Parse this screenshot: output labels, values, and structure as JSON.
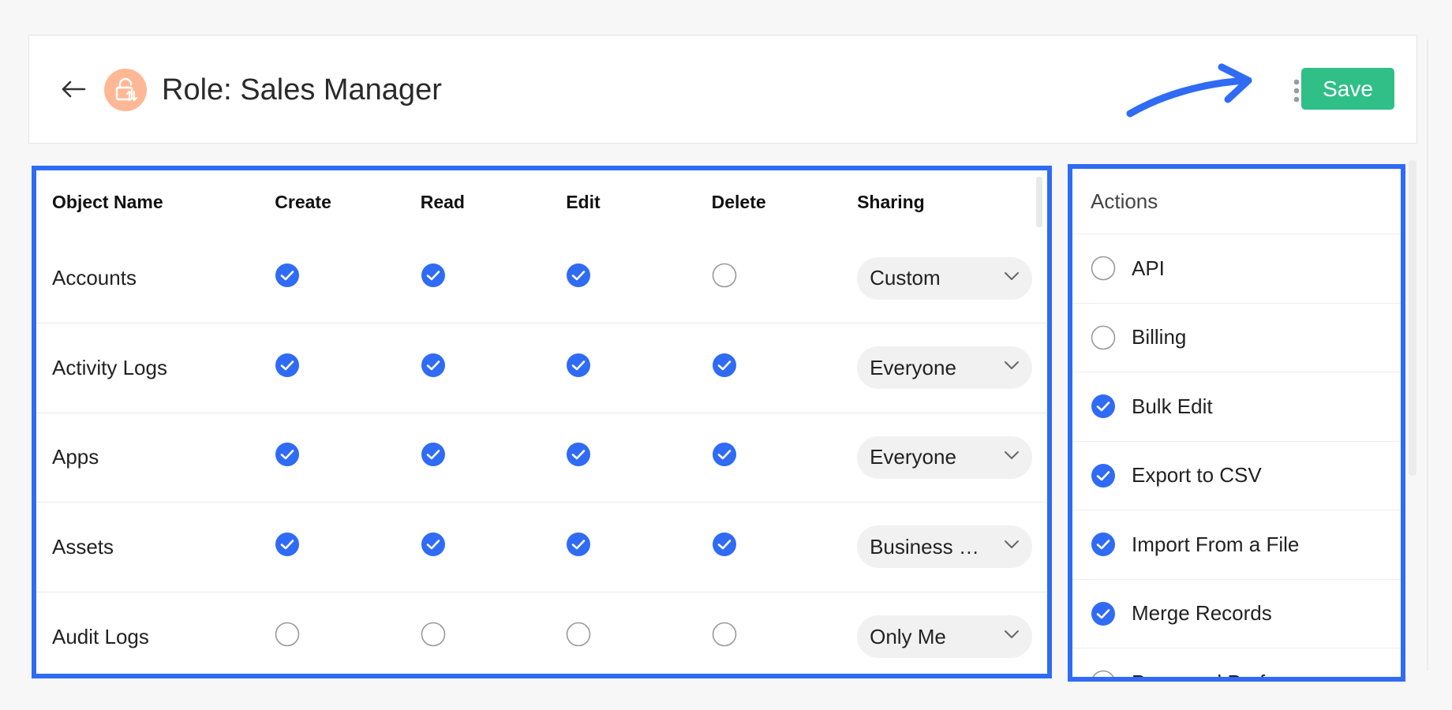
{
  "header": {
    "title": "Role: Sales Manager",
    "save_label": "Save",
    "accent_color": "#2f6bf4",
    "save_color": "#2fbf87",
    "avatar_color": "#ffb896"
  },
  "permissions": {
    "columns": [
      "Object Name",
      "Create",
      "Read",
      "Edit",
      "Delete",
      "Sharing"
    ],
    "rows": [
      {
        "name": "Accounts",
        "create": true,
        "read": true,
        "edit": true,
        "delete": false,
        "sharing": "Custom"
      },
      {
        "name": "Activity Logs",
        "create": true,
        "read": true,
        "edit": true,
        "delete": true,
        "sharing": "Everyone"
      },
      {
        "name": "Apps",
        "create": true,
        "read": true,
        "edit": true,
        "delete": true,
        "sharing": "Everyone"
      },
      {
        "name": "Assets",
        "create": true,
        "read": true,
        "edit": true,
        "delete": true,
        "sharing": "Business …"
      },
      {
        "name": "Audit Logs",
        "create": false,
        "read": false,
        "edit": false,
        "delete": false,
        "sharing": "Only Me"
      }
    ]
  },
  "actions": {
    "title": "Actions",
    "items": [
      {
        "label": "API",
        "checked": false
      },
      {
        "label": "Billing",
        "checked": false
      },
      {
        "label": "Bulk Edit",
        "checked": true
      },
      {
        "label": "Export to CSV",
        "checked": true
      },
      {
        "label": "Import From a File",
        "checked": true
      },
      {
        "label": "Merge Records",
        "checked": true
      },
      {
        "label": "Password Preferences",
        "checked": false
      }
    ]
  },
  "icons": {
    "back": "arrow-left-icon",
    "avatar": "lock-swap-icon",
    "more": "more-vertical-icon",
    "checked": "check-circle-icon",
    "unchecked": "empty-circle-icon",
    "dropdown": "chevron-down-icon"
  }
}
